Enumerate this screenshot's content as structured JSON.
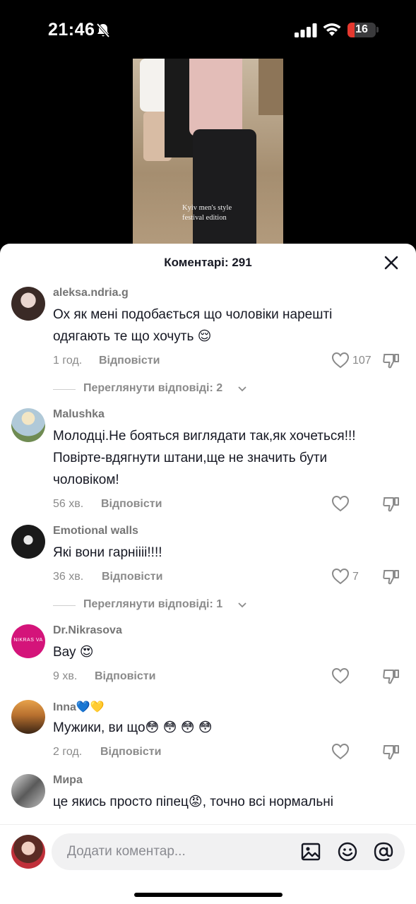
{
  "status_bar": {
    "time": "21:46",
    "battery_level": "16",
    "icons": [
      "bell-slash-icon",
      "signal-icon",
      "wifi-icon",
      "battery-icon"
    ]
  },
  "video": {
    "caption_line1": "Kyiv men's style",
    "caption_line2": "festival edition"
  },
  "sheet": {
    "title": "Коментарі: 291",
    "close_icon": "close-icon"
  },
  "comments": [
    {
      "username": "aleksa.ndria.g",
      "text": "Ох як мені подобається що чоловіки нарешті одягають те що хочуть 😌",
      "ago": "1 год.",
      "reply_label": "Відповісти",
      "likes": "107",
      "view_replies": "Переглянути відповіді: 2"
    },
    {
      "username": "Malushka",
      "text": "Молодці.Не бояться виглядати так,як хочеться!!! Повірте-вдягнути штани,ще не значить бути чоловіком!",
      "ago": "56 хв.",
      "reply_label": "Відповісти",
      "likes": ""
    },
    {
      "username": "Emotional walls",
      "text": "Які вони гарніііі!!!!",
      "ago": "36 хв.",
      "reply_label": "Відповісти",
      "likes": "7",
      "view_replies": "Переглянути відповіді: 1"
    },
    {
      "username": "Dr.Nikrasova",
      "text": "Вау 😍",
      "ago": "9 хв.",
      "reply_label": "Відповісти",
      "likes": "",
      "avatar_text": "NIKRAS VA"
    },
    {
      "username": "Inna💙💛",
      "text": "Мужики, ви що😳 😳 😳 😳",
      "ago": "2 год.",
      "reply_label": "Відповісти",
      "likes": ""
    },
    {
      "username": "Мира",
      "text": "це якись просто піпец😡, точно всі нормальні"
    }
  ],
  "input_bar": {
    "placeholder": "Додати коментар...",
    "icons": [
      "image-icon",
      "emoji-icon",
      "mention-icon"
    ]
  },
  "colors": {
    "accent_battery": "#e5382f",
    "text_primary": "#161823",
    "text_secondary": "#8a8a8a"
  }
}
